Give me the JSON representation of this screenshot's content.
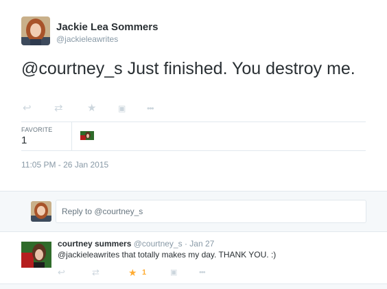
{
  "tweet": {
    "author_name": "Jackie Lea Sommers",
    "author_handle": "@jackieleawrites",
    "text": "@courtney_s Just finished. You destroy me.",
    "actions": {
      "reply_icon": "↩",
      "retweet_icon": "⇄",
      "favorite_icon": "★",
      "save_icon": "▣",
      "more_icon": "•••"
    },
    "stats": {
      "favorite_label": "FAVORITE",
      "favorite_count": "1"
    },
    "timestamp": "11:05 PM - 26 Jan 2015"
  },
  "reply_box": {
    "placeholder": "Reply to @courtney_s"
  },
  "reply": {
    "author_name": "courtney summers",
    "author_handle": "@courtney_s",
    "separator": "·",
    "date": "Jan 27",
    "text": "@jackieleawrites that totally makes my day. THANK YOU. :)",
    "actions": {
      "reply_icon": "↩",
      "retweet_icon": "⇄",
      "favorite_icon": "★",
      "favorite_count": "1",
      "save_icon": "▣",
      "more_icon": "•••"
    }
  },
  "colors": {
    "text": "#292f33",
    "muted": "#8899a6",
    "icon": "#ccd6dd",
    "favorite_active": "#ffac33",
    "border": "#e1e8ed",
    "panel": "#f5f8fa"
  }
}
